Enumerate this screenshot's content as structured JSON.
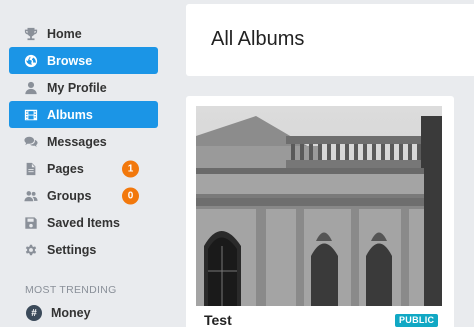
{
  "sidebar": {
    "items": [
      {
        "label": "Home",
        "icon": "trophy-icon"
      },
      {
        "label": "Browse",
        "icon": "globe-icon",
        "active": true
      },
      {
        "label": "My Profile",
        "icon": "user-icon"
      },
      {
        "label": "Albums",
        "icon": "film-icon",
        "active": true
      },
      {
        "label": "Messages",
        "icon": "chat-icon"
      },
      {
        "label": "Pages",
        "icon": "file-icon",
        "badge": "1"
      },
      {
        "label": "Groups",
        "icon": "users-icon",
        "badge": "0"
      },
      {
        "label": "Saved Items",
        "icon": "floppy-icon"
      },
      {
        "label": "Settings",
        "icon": "gear-icon"
      }
    ],
    "trending_title": "MOST TRENDING",
    "trending": [
      {
        "label": "Money",
        "icon": "hash-icon",
        "symbol": "#"
      }
    ]
  },
  "main": {
    "title": "All Albums",
    "albums": [
      {
        "title": "Test",
        "privacy": "PUBLIC"
      }
    ]
  },
  "colors": {
    "accent": "#1b95e6",
    "badge": "#f2780c",
    "privacy_badge": "#11a8c4",
    "background": "#e9ebee"
  }
}
